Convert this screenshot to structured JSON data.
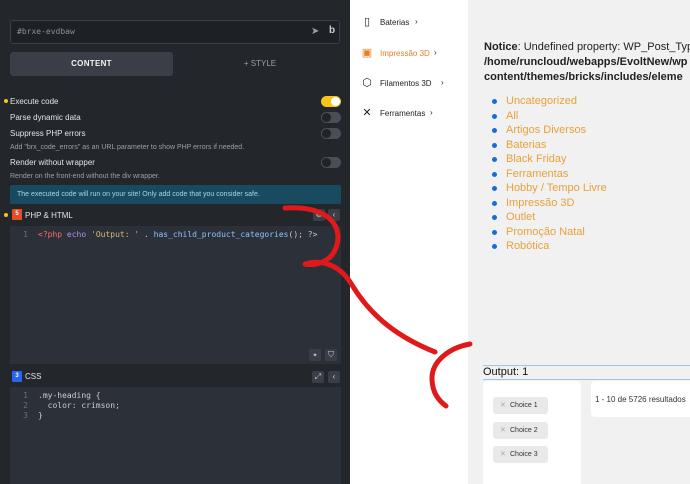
{
  "builder": {
    "element_id": "#brxe-evdbaw",
    "tabs": {
      "content": "CONTENT",
      "style": "+ STYLE"
    },
    "options": {
      "execute_code": "Execute code",
      "parse_dynamic": "Parse dynamic data",
      "suppress_errors": "Suppress PHP errors",
      "suppress_hint": "Add \"brx_code_errors\" as an URL parameter to show PHP errors if needed.",
      "render_without_wrapper": "Render without wrapper",
      "wrapper_hint": "Render on the front-end without the div wrapper."
    },
    "warning": "The executed code will run on your site! Only add code that you consider safe.",
    "php_section": {
      "title": "PHP & HTML",
      "line_number": "1"
    },
    "css_section": {
      "title": "CSS",
      "line_numbers": [
        "1",
        "2",
        "3"
      ],
      "lines": [
        ".my-heading {",
        "  color: crimson;",
        "}"
      ]
    }
  },
  "php_code": {
    "open": "<?php",
    "echo": "echo",
    "string": "'Output: '",
    "dot": " . ",
    "fn": "has_child_product_categories",
    "rest": "(); ?>"
  },
  "nav": {
    "items": [
      {
        "label": "Baterias",
        "icon": "battery-icon"
      },
      {
        "label": "Impressão 3D",
        "icon": "printer-3d-icon"
      },
      {
        "label": "Filamentos 3D",
        "icon": "hexagon-icon"
      },
      {
        "label": "Ferramentas",
        "icon": "tools-icon"
      }
    ]
  },
  "notice": {
    "prefix": "Notice",
    "message": ": Undefined property: WP_Post_Typ",
    "path_line1": "/home/runcloud/webapps/EvoltNew/wp",
    "path_line2": "content/themes/bricks/includes/eleme"
  },
  "categories": [
    "Uncategorized",
    "All",
    "Artigos Diversos",
    "Baterias",
    "Black Friday",
    "Ferramentas",
    "Hobby / Tempo Livre",
    "Impressão 3D",
    "Outlet",
    "Promoção Natal",
    "Robótica"
  ],
  "output_text": "Output: 1",
  "choices": [
    "Choice 1",
    "Choice 2",
    "Choice 3"
  ],
  "results_text": "1 - 10 de 5726 resultados",
  "colors": {
    "accent": "#f5c518",
    "link": "#e8a13a",
    "annotation": "#e0191b"
  }
}
